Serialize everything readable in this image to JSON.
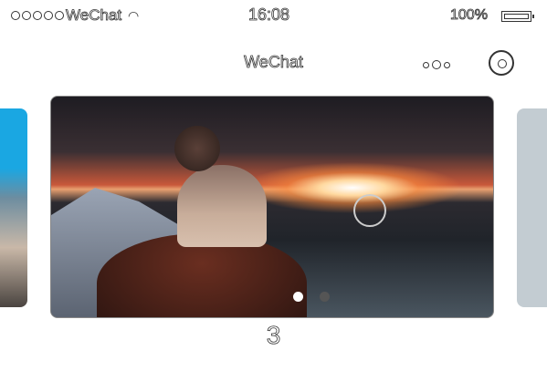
{
  "status_bar": {
    "carrier": "WeChat",
    "time": "16:08",
    "battery": "100%",
    "wifi_icon": "wifi-icon",
    "battery_icon": "battery-icon"
  },
  "nav": {
    "title": "WeChat",
    "more_icon": "more-icon",
    "close_icon": "close-icon"
  },
  "carousel": {
    "active_index": 0,
    "dot_count": 2,
    "dot_active_color": "#ffffff",
    "dot_inactive_color": "#555555"
  },
  "page_number": "3"
}
